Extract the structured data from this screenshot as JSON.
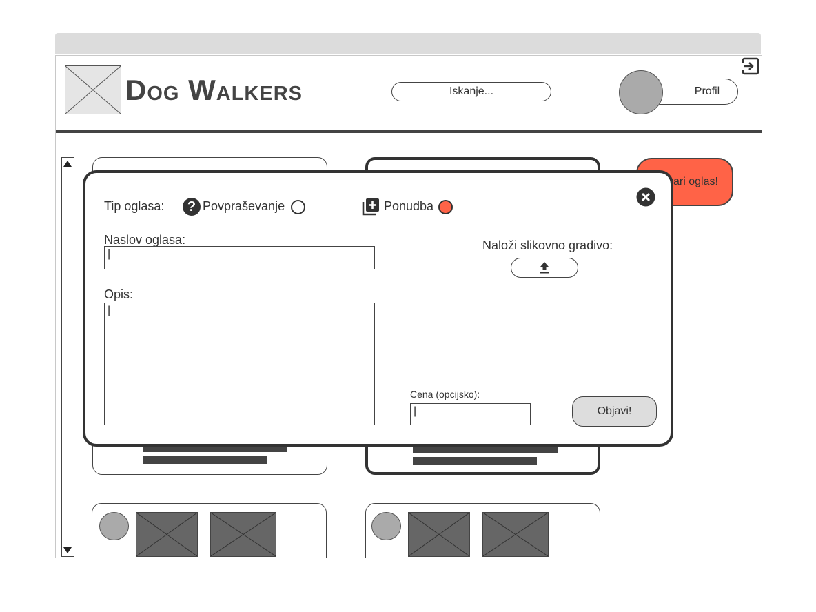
{
  "header": {
    "brand": "Dog Walkers",
    "search_placeholder": "Iskanje...",
    "profile_label": "Profil"
  },
  "create_button": {
    "label": "Ustvari oglas!"
  },
  "modal": {
    "type_label": "Tip oglasa:",
    "option_request": "Povpraševanje",
    "option_offer": "Ponudba",
    "selected_option": "Ponudba",
    "title_label": "Naslov oglasa:",
    "title_value": "|",
    "description_label": "Opis:",
    "description_value": "|",
    "upload_label": "Naloži slikovno gradivo:",
    "price_label": "Cena (opcijsko):",
    "price_value": "|",
    "publish_label": "Objavi!"
  },
  "colors": {
    "accent": "#ff6347",
    "dark": "#333333",
    "placeholder": "#666666"
  },
  "icons": {
    "logout": "logout-icon",
    "help": "question-icon",
    "offer": "library-add-icon",
    "close": "close-icon",
    "upload": "upload-icon"
  }
}
